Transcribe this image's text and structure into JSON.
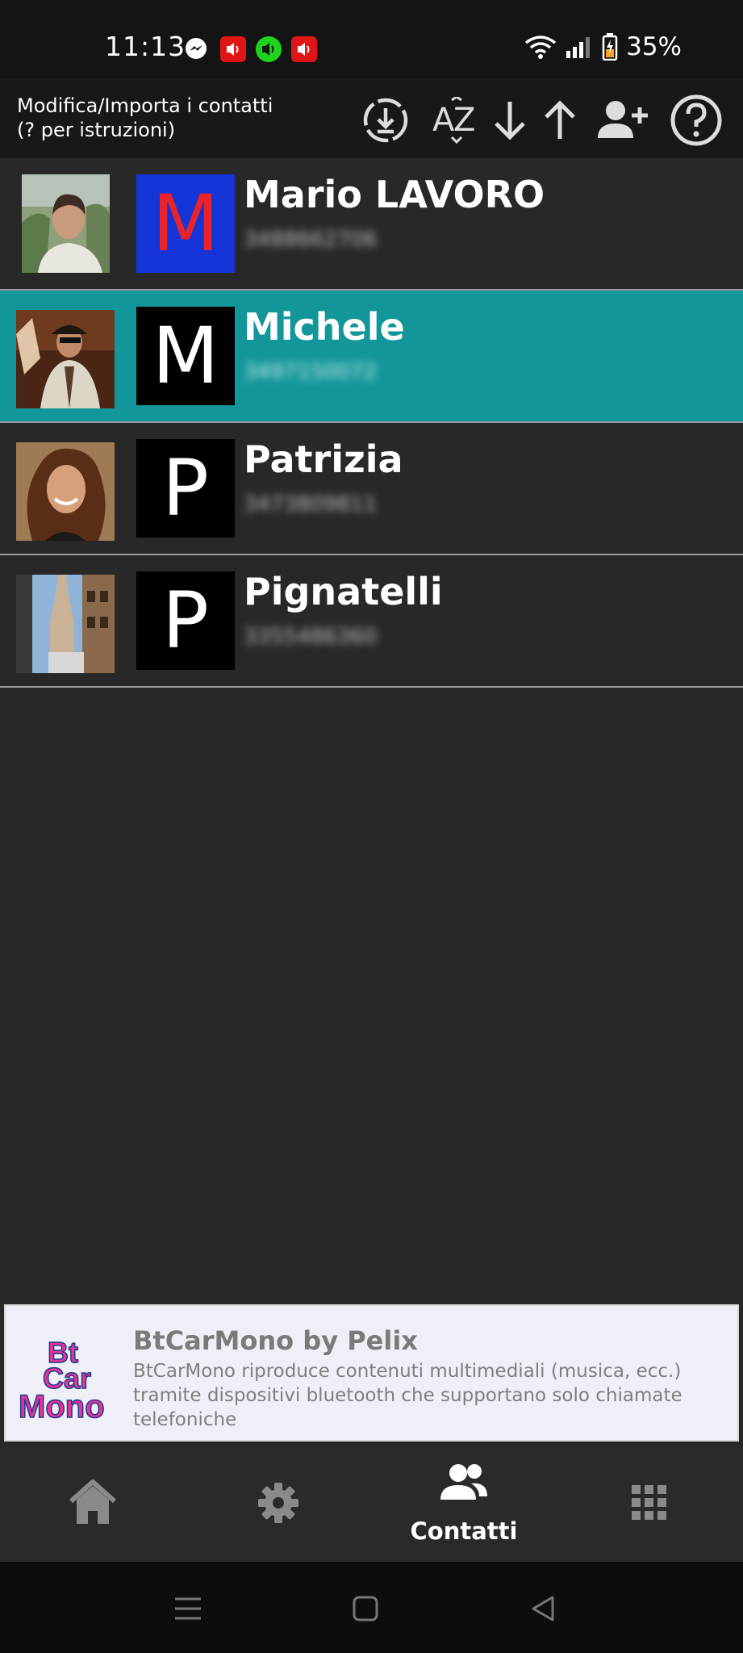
{
  "status_bar": {
    "time": "11:13",
    "battery": "35%",
    "icons": [
      "messenger-icon",
      "red-speaker-icon",
      "green-speaker-icon",
      "red-speaker-icon",
      "wifi-icon",
      "signal-icon",
      "battery-icon"
    ]
  },
  "toolbar": {
    "title_line1": "Modifica/Importa i contatti",
    "title_line2": "(? per istruzioni)",
    "icons": [
      "import-icon",
      "sort-az-icon",
      "arrow-down-icon",
      "arrow-up-icon",
      "add-contact-icon",
      "help-icon"
    ]
  },
  "contacts": [
    {
      "name": "Mario LAVORO",
      "letter": "M",
      "letter_color": "#e8232a",
      "box_color": "#1534d8",
      "phone": "3488662706",
      "selected": false
    },
    {
      "name": "Michele",
      "letter": "M",
      "letter_color": "#ffffff",
      "box_color": "#000000",
      "phone": "3497150072",
      "selected": true
    },
    {
      "name": "Patrizia",
      "letter": "P",
      "letter_color": "#ffffff",
      "box_color": "#000000",
      "phone": "3473809811",
      "selected": false
    },
    {
      "name": "Pignatelli",
      "letter": "P",
      "letter_color": "#ffffff",
      "box_color": "#000000",
      "phone": "3355486360",
      "selected": false
    }
  ],
  "ad": {
    "logo_line1": "Bt",
    "logo_line2": "Car",
    "logo_line3": "Mono",
    "title": "BtCarMono by Pelix",
    "description": "BtCarMono riproduce contenuti multimediali (musica, ecc.) tramite dispositivi bluetooth che supportano solo chiamate telefoniche"
  },
  "bottom_nav": {
    "active_label": "Contatti",
    "items": [
      "home-icon",
      "settings-icon",
      "contacts-icon",
      "apps-grid-icon"
    ]
  },
  "colors": {
    "selected_row": "#13969a",
    "background": "#282828",
    "inactive_icon": "#8a8a8a"
  }
}
